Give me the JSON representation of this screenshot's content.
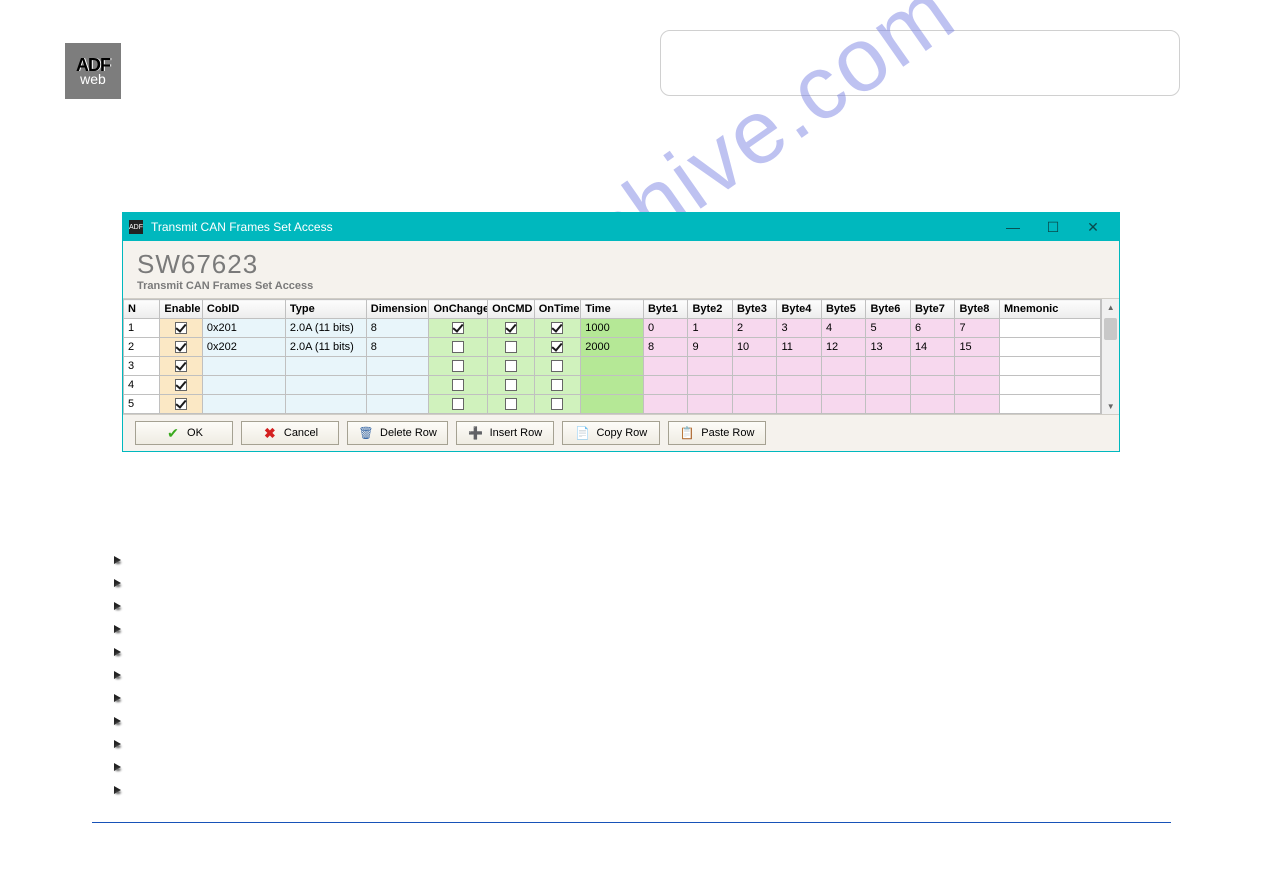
{
  "logo": {
    "line1": "ADF",
    "line2": "web"
  },
  "watermark": "manualshive.com",
  "window": {
    "title": "Transmit CAN Frames Set Access",
    "sw_code": "SW67623",
    "subtitle": "Transmit CAN Frames Set Access"
  },
  "columns": [
    "N",
    "Enable",
    "CobID",
    "Type",
    "Dimension",
    "OnChange",
    "OnCMD",
    "OnTimer",
    "Time",
    "Byte1",
    "Byte2",
    "Byte3",
    "Byte4",
    "Byte5",
    "Byte6",
    "Byte7",
    "Byte8",
    "Mnemonic"
  ],
  "rows": [
    {
      "n": "1",
      "enable": true,
      "cobid": "0x201",
      "type": "2.0A (11 bits)",
      "dim": "8",
      "onchange": true,
      "oncmd": true,
      "ontimer": true,
      "time": "1000",
      "b1": "0",
      "b2": "1",
      "b3": "2",
      "b4": "3",
      "b5": "4",
      "b6": "5",
      "b7": "6",
      "b8": "7",
      "mnem": ""
    },
    {
      "n": "2",
      "enable": true,
      "cobid": "0x202",
      "type": "2.0A (11 bits)",
      "dim": "8",
      "onchange": false,
      "oncmd": false,
      "ontimer": true,
      "time": "2000",
      "b1": "8",
      "b2": "9",
      "b3": "10",
      "b4": "11",
      "b5": "12",
      "b6": "13",
      "b7": "14",
      "b8": "15",
      "mnem": ""
    },
    {
      "n": "3",
      "enable": true,
      "cobid": "",
      "type": "",
      "dim": "",
      "onchange": false,
      "oncmd": false,
      "ontimer": false,
      "time": "",
      "b1": "",
      "b2": "",
      "b3": "",
      "b4": "",
      "b5": "",
      "b6": "",
      "b7": "",
      "b8": "",
      "mnem": ""
    },
    {
      "n": "4",
      "enable": true,
      "cobid": "",
      "type": "",
      "dim": "",
      "onchange": false,
      "oncmd": false,
      "ontimer": false,
      "time": "",
      "b1": "",
      "b2": "",
      "b3": "",
      "b4": "",
      "b5": "",
      "b6": "",
      "b7": "",
      "b8": "",
      "mnem": ""
    },
    {
      "n": "5",
      "enable": true,
      "cobid": "",
      "type": "",
      "dim": "",
      "onchange": false,
      "oncmd": false,
      "ontimer": false,
      "time": "",
      "b1": "",
      "b2": "",
      "b3": "",
      "b4": "",
      "b5": "",
      "b6": "",
      "b7": "",
      "b8": "",
      "mnem": ""
    }
  ],
  "buttons": {
    "ok": "OK",
    "cancel": "Cancel",
    "delete_row": "Delete Row",
    "insert_row": "Insert Row",
    "copy_row": "Copy Row",
    "paste_row": "Paste Row"
  }
}
